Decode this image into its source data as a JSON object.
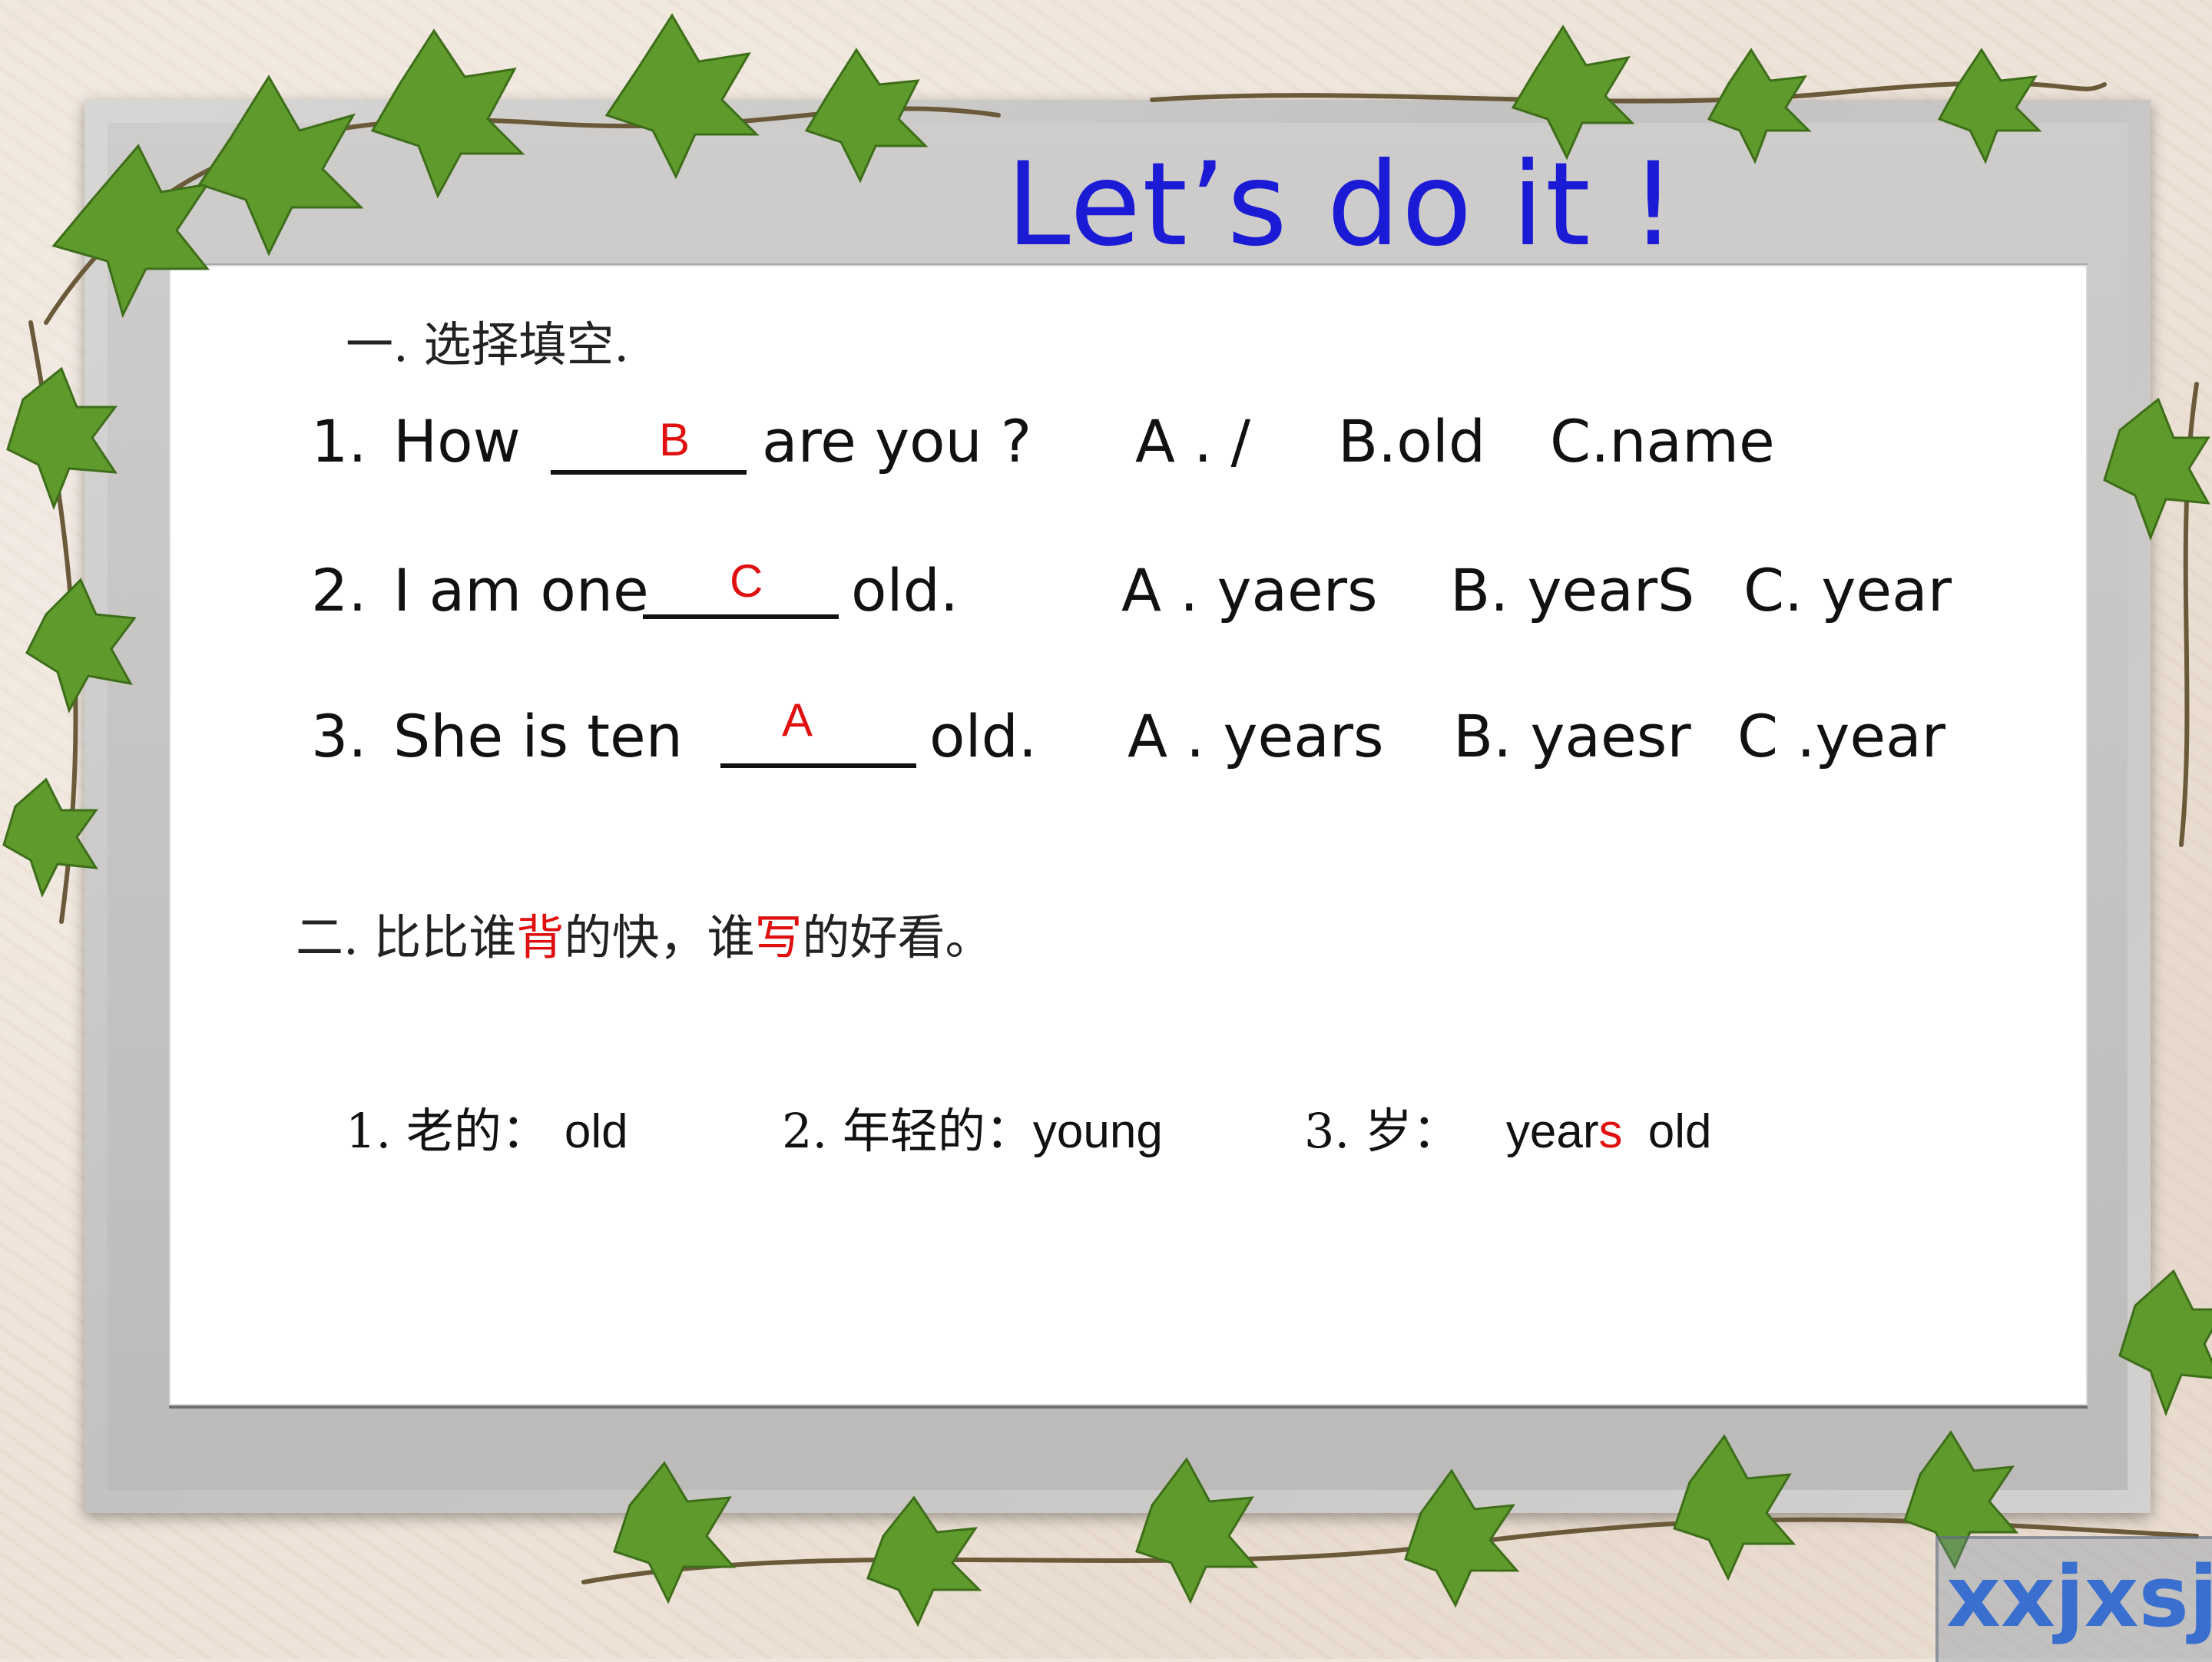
{
  "title": "Let’s do it !",
  "section1": {
    "heading": "一. 选择填空.",
    "questions": [
      {
        "number": "1.",
        "before": "How",
        "answer": "B",
        "after": "are you ?",
        "options": [
          "A . /",
          "B.old",
          "C.name"
        ]
      },
      {
        "number": "2.",
        "before": "I am one",
        "answer": "C",
        "after": "old.",
        "options": [
          "A . yaers",
          "B. yearS",
          "C. year"
        ]
      },
      {
        "number": "3.",
        "before": "She  is ten",
        "answer": "A",
        "after": "old.",
        "options": [
          "A . years",
          "B. yaesr",
          "C .year"
        ]
      }
    ]
  },
  "section2": {
    "heading_part1": "二.  比比谁",
    "heading_red1": "背",
    "heading_part2": "的快，谁",
    "heading_red2": "写",
    "heading_part3": "的好看。",
    "vocab": [
      {
        "label": "1. 老的：",
        "word": "old"
      },
      {
        "label": "2. 年轻的：",
        "word": "young"
      },
      {
        "label": "3. 岁：",
        "word_a": "year",
        "word_red": "s",
        "word_b": " old"
      }
    ]
  },
  "watermark": "xxjxsj.cn",
  "colors": {
    "title": "#1b1bd6",
    "answer": "#e01010",
    "board": "#ffffff",
    "frame": "#c4c2c0"
  }
}
